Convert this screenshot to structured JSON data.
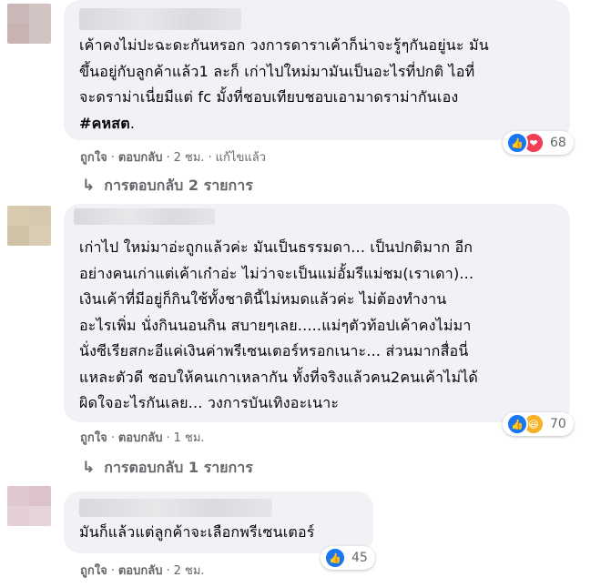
{
  "comments": [
    {
      "text_lines": [
        "เค้าคงไม่ปะฉะดะกันหรอก วงการดาราเค้าก็น่าจะรู้ๆกันอยู่นะ มัน",
        "ขึ้นอยู่กับลูกค้าแล้ว1 ละก็ เก่าไปใหม่มามันเป็นอะไรที่ปกติ ไอที่",
        "จะดราม่าเนี่ยมีแต่ fc มั้งที่ชอบเทียบชอบเอามาดราม่ากันเอง"
      ],
      "hashtag": "#คหสต",
      "hashtag_suffix": ".",
      "reactions": [
        "like",
        "love"
      ],
      "reaction_count": "68",
      "like_label": "ถูกใจ",
      "reply_label": "ตอบกลับ",
      "time": "2 ชม.",
      "edited_label": "แก้ไขแล้ว",
      "replies_label": "การตอบกลับ 2 รายการ"
    },
    {
      "text_lines": [
        "เก่าไป ใหม่มาอ่ะถูกแล้วค่ะ มันเป็นธรรมดา... เป็นปกติมาก อีก",
        "อย่างคนเก่าแต่เค้าเก๋าอ่ะ ไม่ว่าจะเป็นแม่อั้มรีแม่ชม(เราเดา)...",
        "เงินเค้าที่มีอยู่ก็กินใช้ทั้งชาตินี้ไม่หมดแล้วค่ะ ไม่ต้องทำงาน",
        "อะไรเพิ่ม นั่งกินนอนกิน สบายๆเลย.....แม่ๆตัวท้อปเค้าคงไม่มา",
        "นั่งซีเรียสกะอีแค่เงินค่าพรีเซนเตอร์หรอกเนาะ... ส่วนมากสื่อนี่",
        "แหละตัวดี ชอบให้คนเกาเหลากัน ทั้งที่จริงแล้วคน2คนเค้าไม่ได้",
        "ผิดใจอะไรกันเลย... วงการบันเทิงอะเนาะ"
      ],
      "reactions": [
        "like",
        "haha"
      ],
      "reaction_count": "70",
      "like_label": "ถูกใจ",
      "reply_label": "ตอบกลับ",
      "time": "1 ชม.",
      "replies_label": "การตอบกลับ 1 รายการ"
    },
    {
      "text_lines": [
        "มันก็แล้วแต่ลูกค้าจะเลือกพรีเซนเตอร์"
      ],
      "reactions": [
        "like"
      ],
      "reaction_count": "45",
      "like_label": "ถูกใจ",
      "reply_label": "ตอบกลับ",
      "time": "2 ชม."
    }
  ],
  "colors": {
    "bubble": "#f0f2f5",
    "meta_text": "#65676b",
    "like_blue": "#1877f2",
    "love_red": "#f33e58",
    "haha_yellow": "#f7b125"
  },
  "icons": {
    "reply_arrow": "reply-arrow-icon",
    "like": "thumbs-up-icon",
    "love": "heart-icon",
    "haha": "laughing-face-icon"
  }
}
